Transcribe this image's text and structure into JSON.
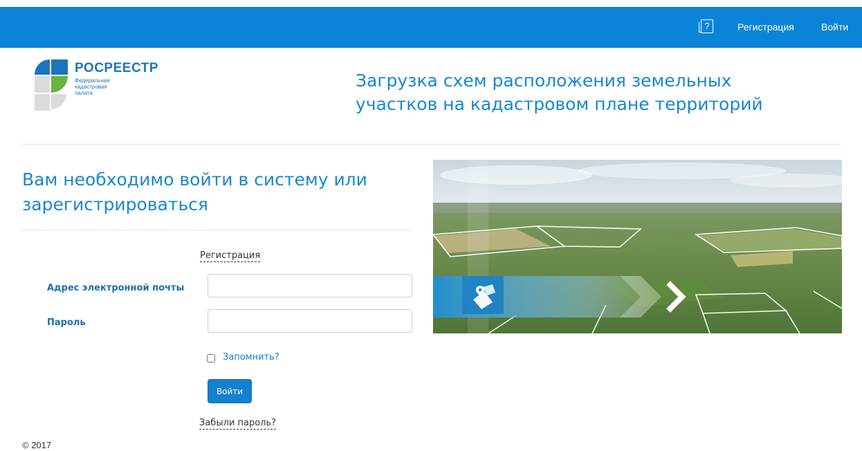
{
  "topnav": {
    "help_icon": "help-book-icon",
    "register_label": "Регистрация",
    "login_label": "Войти"
  },
  "logo": {
    "title": "РОСРЕЕСТР",
    "subtitle_line1": "Федеральная",
    "subtitle_line2": "кадастровая",
    "subtitle_line3": "палата"
  },
  "page": {
    "title": "Загрузка схем расположения земельных участков на кадастровом плане территорий"
  },
  "login": {
    "heading": "Вам необходимо войти в систему или зарегистрироваться",
    "register_link": "Регистрация",
    "email_label": "Адрес электронной почты",
    "email_value": "",
    "password_label": "Пароль",
    "password_value": "",
    "remember_label": "Запомнить?",
    "remember_checked": false,
    "submit_label": "Войти",
    "forgot_link": "Забыли пароль?"
  },
  "banner": {
    "image": "aerial-fields-photo",
    "map_icon": "map-pin-icon",
    "arrow_icon": "chevron-right-icon"
  },
  "footer": {
    "copyright": "© 2017"
  },
  "colors": {
    "topbar": "#0a84d8",
    "accent": "#1788cf",
    "label": "#1a6fb5",
    "button": "#1480d0"
  }
}
